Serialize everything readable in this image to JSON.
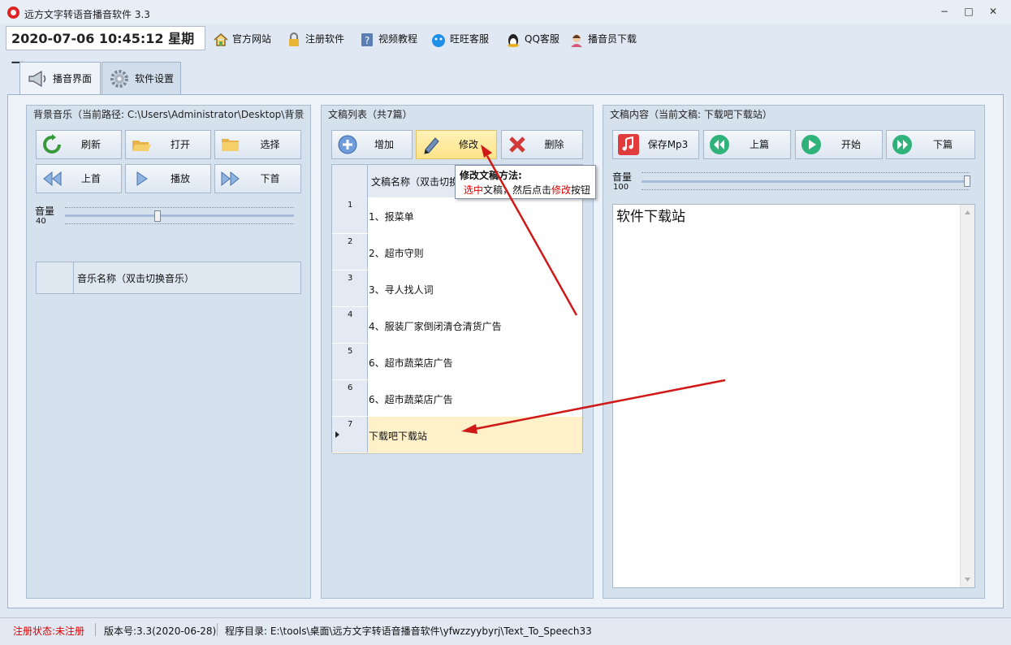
{
  "window": {
    "title": "远方文字转语音播音软件 3.3",
    "minimize": "−",
    "restore": "□",
    "close": "✕"
  },
  "toolbar": {
    "datetime": "2020-07-06 10:45:12 星期一",
    "links": [
      {
        "label": "官方网站",
        "icon": "home-icon"
      },
      {
        "label": "注册软件",
        "icon": "lock-icon"
      },
      {
        "label": "视频教程",
        "icon": "help-book-icon"
      },
      {
        "label": "旺旺客服",
        "icon": "wangwang-icon"
      },
      {
        "label": "QQ客服",
        "icon": "qq-penguin-icon"
      },
      {
        "label": "播音员下载",
        "icon": "announcer-icon"
      }
    ]
  },
  "tabs": [
    {
      "label": "播音界面",
      "icon": "megaphone-icon",
      "active": true
    },
    {
      "label": "软件设置",
      "icon": "gear-icon",
      "active": false
    }
  ],
  "bg_music": {
    "title": "背景音乐（当前路径: C:\\Users\\Administrator\\Desktop\\背景",
    "buttons": {
      "refresh": "刷新",
      "open": "打开",
      "select": "选择",
      "prev": "上首",
      "play": "播放",
      "next": "下首"
    },
    "volume_label": "音量",
    "volume": 40,
    "list_header": "音乐名称（双击切换音乐）"
  },
  "manuscripts": {
    "title": "文稿列表（共7篇）",
    "buttons": {
      "add": "增加",
      "edit": "修改",
      "delete": "删除"
    },
    "list_header": "文稿名称（双击切换",
    "rows": [
      {
        "num": "1",
        "name": "1、报菜单"
      },
      {
        "num": "2",
        "name": "2、超市守则"
      },
      {
        "num": "3",
        "name": "3、寻人找人词"
      },
      {
        "num": "4",
        "name": "4、服装厂家倒闭清仓清货广告"
      },
      {
        "num": "5",
        "name": "6、超市蔬菜店广告"
      },
      {
        "num": "6",
        "name": "6、超市蔬菜店广告"
      },
      {
        "num": "7",
        "name": "下载吧下载站"
      }
    ],
    "selected_index": 6,
    "tooltip": {
      "title": "修改文稿方法:",
      "part1": "选中",
      "part2": "文稿，然后点击",
      "part3": "修改",
      "part4": "按钮"
    }
  },
  "content": {
    "title": "文稿内容（当前文稿: 下载吧下载站）",
    "buttons": {
      "save_mp3": "保存Mp3",
      "prev": "上篇",
      "start": "开始",
      "next": "下篇"
    },
    "volume_label": "音量",
    "volume": 100,
    "text": "软件下载站"
  },
  "status": {
    "reg_label": "注册状态:",
    "reg_value": "未注册",
    "version": "版本号:3.3(2020-06-28)",
    "dir": "程序目录: E:\\tools\\桌面\\远方文字转语音播音软件\\yfwzzyybyrj\\Text_To_Speech33"
  },
  "colors": {
    "accent_red": "#dd0000",
    "selected_row": "#fff1c9",
    "highlight_button": "#fde389"
  }
}
